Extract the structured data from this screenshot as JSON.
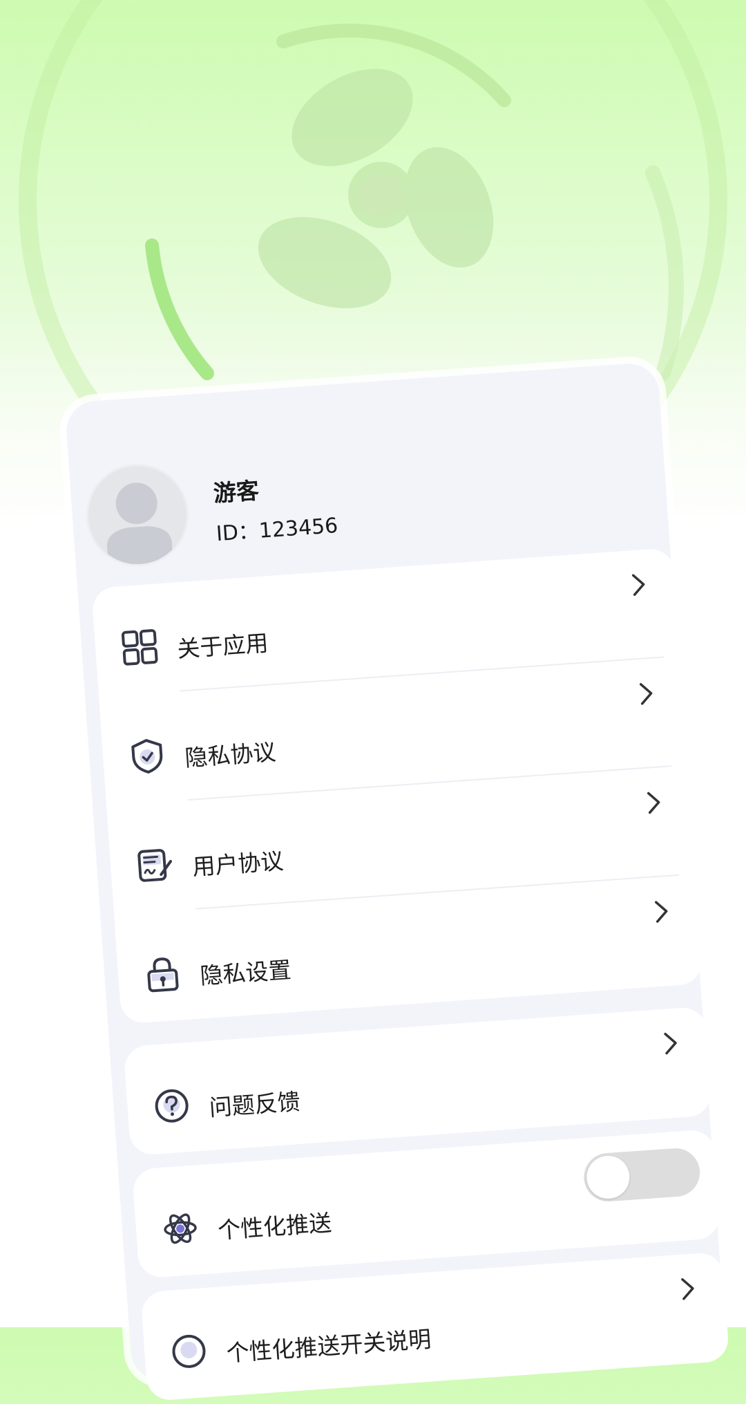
{
  "theme": {
    "accent": "#c7f7a9",
    "card_bg": "#f2f4fa",
    "icon_color": "#353848",
    "toggle_off": "#dddddd"
  },
  "profile": {
    "name": "游客",
    "id_text": "ID：123456",
    "avatar_icon": "default-person-avatar"
  },
  "menu_group_1": [
    {
      "label": "关于应用",
      "icon": "grid-apps-icon"
    },
    {
      "label": "隐私协议",
      "icon": "shield-check-icon"
    },
    {
      "label": "用户协议",
      "icon": "document-sign-icon"
    },
    {
      "label": "隐私设置",
      "icon": "lock-icon"
    }
  ],
  "feedback": {
    "label": "问题反馈",
    "icon": "question-circle-icon"
  },
  "personalized_push": {
    "label": "个性化推送",
    "icon": "atom-icon",
    "enabled": false
  },
  "push_explanation": {
    "label": "个性化推送开关说明",
    "icon": "info-circle-icon"
  }
}
